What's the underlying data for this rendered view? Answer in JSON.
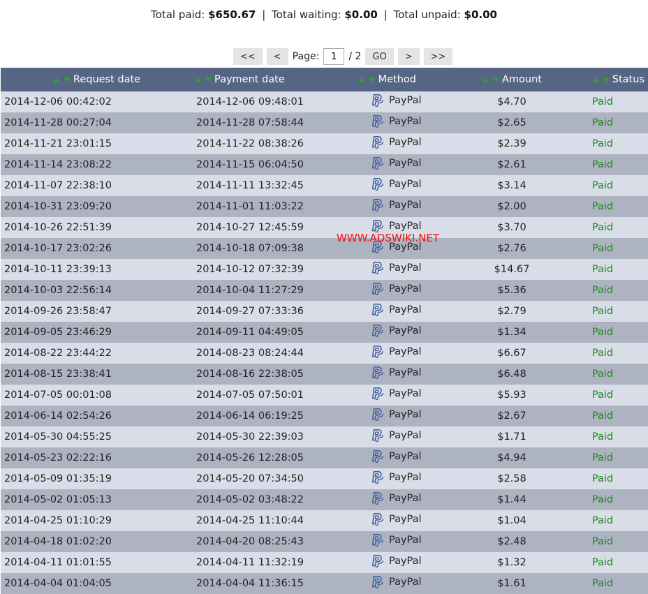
{
  "totals": {
    "paid_label": "Total paid:",
    "paid_value": "$650.67",
    "separator": "|",
    "waiting_label": "Total waiting:",
    "waiting_value": "$0.00",
    "unpaid_label": "Total unpaid:",
    "unpaid_value": "$0.00"
  },
  "pagination": {
    "first_label": "<<",
    "prev_label": "<",
    "page_label": "Page:",
    "current_page": "1",
    "total_pages": "/ 2",
    "go_label": "GO",
    "next_label": ">",
    "last_label": ">>"
  },
  "table": {
    "columns": [
      "Request date",
      "Payment date",
      "Method",
      "Amount",
      "Status"
    ],
    "rows": [
      {
        "request": "2014-12-06 00:42:02",
        "payment": "2014-12-06 09:48:01",
        "method": "PayPal",
        "amount": "$4.70",
        "status": "Paid"
      },
      {
        "request": "2014-11-28 00:27:04",
        "payment": "2014-11-28 07:58:44",
        "method": "PayPal",
        "amount": "$2.65",
        "status": "Paid"
      },
      {
        "request": "2014-11-21 23:01:15",
        "payment": "2014-11-22 08:38:26",
        "method": "PayPal",
        "amount": "$2.39",
        "status": "Paid"
      },
      {
        "request": "2014-11-14 23:08:22",
        "payment": "2014-11-15 06:04:50",
        "method": "PayPal",
        "amount": "$2.61",
        "status": "Paid"
      },
      {
        "request": "2014-11-07 22:38:10",
        "payment": "2014-11-11 13:32:45",
        "method": "PayPal",
        "amount": "$3.14",
        "status": "Paid"
      },
      {
        "request": "2014-10-31 23:09:20",
        "payment": "2014-11-01 11:03:22",
        "method": "PayPal",
        "amount": "$2.00",
        "status": "Paid"
      },
      {
        "request": "2014-10-26 22:51:39",
        "payment": "2014-10-27 12:45:59",
        "method": "PayPal",
        "amount": "$3.70",
        "status": "Paid"
      },
      {
        "request": "2014-10-17 23:02:26",
        "payment": "2014-10-18 07:09:38",
        "method": "PayPal",
        "amount": "$2.76",
        "status": "Paid"
      },
      {
        "request": "2014-10-11 23:39:13",
        "payment": "2014-10-12 07:32:39",
        "method": "PayPal",
        "amount": "$14.67",
        "status": "Paid"
      },
      {
        "request": "2014-10-03 22:56:14",
        "payment": "2014-10-04 11:27:29",
        "method": "PayPal",
        "amount": "$5.36",
        "status": "Paid"
      },
      {
        "request": "2014-09-26 23:58:47",
        "payment": "2014-09-27 07:33:36",
        "method": "PayPal",
        "amount": "$2.79",
        "status": "Paid"
      },
      {
        "request": "2014-09-05 23:46:29",
        "payment": "2014-09-11 04:49:05",
        "method": "PayPal",
        "amount": "$1.34",
        "status": "Paid"
      },
      {
        "request": "2014-08-22 23:44:22",
        "payment": "2014-08-23 08:24:44",
        "method": "PayPal",
        "amount": "$6.67",
        "status": "Paid"
      },
      {
        "request": "2014-08-15 23:38:41",
        "payment": "2014-08-16 22:38:05",
        "method": "PayPal",
        "amount": "$6.48",
        "status": "Paid"
      },
      {
        "request": "2014-07-05 00:01:08",
        "payment": "2014-07-05 07:50:01",
        "method": "PayPal",
        "amount": "$5.93",
        "status": "Paid"
      },
      {
        "request": "2014-06-14 02:54:26",
        "payment": "2014-06-14 06:19:25",
        "method": "PayPal",
        "amount": "$2.67",
        "status": "Paid"
      },
      {
        "request": "2014-05-30 04:55:25",
        "payment": "2014-05-30 22:39:03",
        "method": "PayPal",
        "amount": "$1.71",
        "status": "Paid"
      },
      {
        "request": "2014-05-23 02:22:16",
        "payment": "2014-05-26 12:28:05",
        "method": "PayPal",
        "amount": "$4.94",
        "status": "Paid"
      },
      {
        "request": "2014-05-09 01:35:19",
        "payment": "2014-05-20 07:34:50",
        "method": "PayPal",
        "amount": "$2.58",
        "status": "Paid"
      },
      {
        "request": "2014-05-02 01:05:13",
        "payment": "2014-05-02 03:48:22",
        "method": "PayPal",
        "amount": "$1.44",
        "status": "Paid"
      },
      {
        "request": "2014-04-25 01:10:29",
        "payment": "2014-04-25 11:10:44",
        "method": "PayPal",
        "amount": "$1.04",
        "status": "Paid"
      },
      {
        "request": "2014-04-18 01:02:20",
        "payment": "2014-04-20 08:25:43",
        "method": "PayPal",
        "amount": "$2.48",
        "status": "Paid"
      },
      {
        "request": "2014-04-11 01:01:55",
        "payment": "2014-04-11 11:32:19",
        "method": "PayPal",
        "amount": "$1.32",
        "status": "Paid"
      },
      {
        "request": "2014-04-04 01:04:05",
        "payment": "2014-04-04 11:36:15",
        "method": "PayPal",
        "amount": "$1.61",
        "status": "Paid"
      }
    ]
  },
  "watermark": "WWW.ADSWIKI.NET",
  "colors": {
    "header_bg": "#566583",
    "row_light": "#d9dde8",
    "row_dark": "#aeb3c2",
    "status_paid": "#1c8a1c",
    "sort_arrow": "#2da12d",
    "watermark": "#ee1111"
  },
  "icons": {
    "method": "paypal-icon",
    "sort_up": "sort-asc-icon",
    "sort_down": "sort-desc-icon"
  }
}
